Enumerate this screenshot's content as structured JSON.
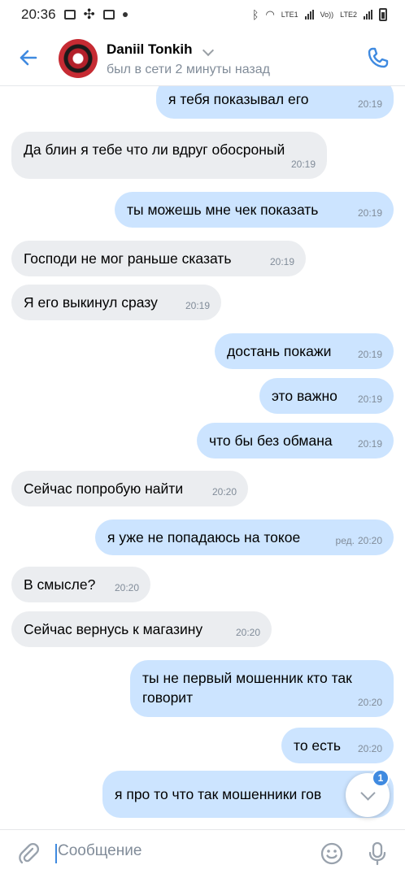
{
  "statusbar": {
    "time": "20:36",
    "lte1": "LTE1",
    "lte2": "LTE2",
    "volte": "Vo))"
  },
  "header": {
    "name": "Daniil Tonkih",
    "status": "был в сети 2 минуты назад"
  },
  "messages": [
    {
      "dir": "out",
      "text": "я тебя показывал его",
      "time": "20:19"
    },
    {
      "dir": "in",
      "text": "Да блин я тебе что ли вдруг обосроный",
      "time": "20:19"
    },
    {
      "dir": "out",
      "text": "ты можешь мне чек показать",
      "time": "20:19"
    },
    {
      "dir": "in",
      "text": "Господи не мог раньше сказать",
      "time": "20:19"
    },
    {
      "dir": "in",
      "text": "Я его выкинул сразу",
      "time": "20:19"
    },
    {
      "dir": "out",
      "text": "достань покажи",
      "time": "20:19"
    },
    {
      "dir": "out",
      "text": "это важно",
      "time": "20:19"
    },
    {
      "dir": "out",
      "text": "что бы без обмана",
      "time": "20:19"
    },
    {
      "dir": "in",
      "text": "Сейчас попробую найти",
      "time": "20:20"
    },
    {
      "dir": "out",
      "text": "я уже не попадаюсь на токое",
      "time": "20:20",
      "edited": "ред."
    },
    {
      "dir": "in",
      "text": "В смысле?",
      "time": "20:20"
    },
    {
      "dir": "in",
      "text": "Сейчас вернусь к магазину",
      "time": "20:20"
    },
    {
      "dir": "out",
      "text": "ты не первый мошенник кто так говорит",
      "time": "20:20"
    },
    {
      "dir": "out",
      "text": "то есть",
      "time": "20:20"
    },
    {
      "dir": "out",
      "text": "я про то что так мошенники гов",
      "time": ""
    }
  ],
  "scroll": {
    "badge": "1"
  },
  "composer": {
    "placeholder": "Сообщение"
  },
  "colors": {
    "accent": "#3f8ae0",
    "incoming": "#ebedf0",
    "outgoing": "#cce4ff",
    "meta": "#818c99"
  }
}
